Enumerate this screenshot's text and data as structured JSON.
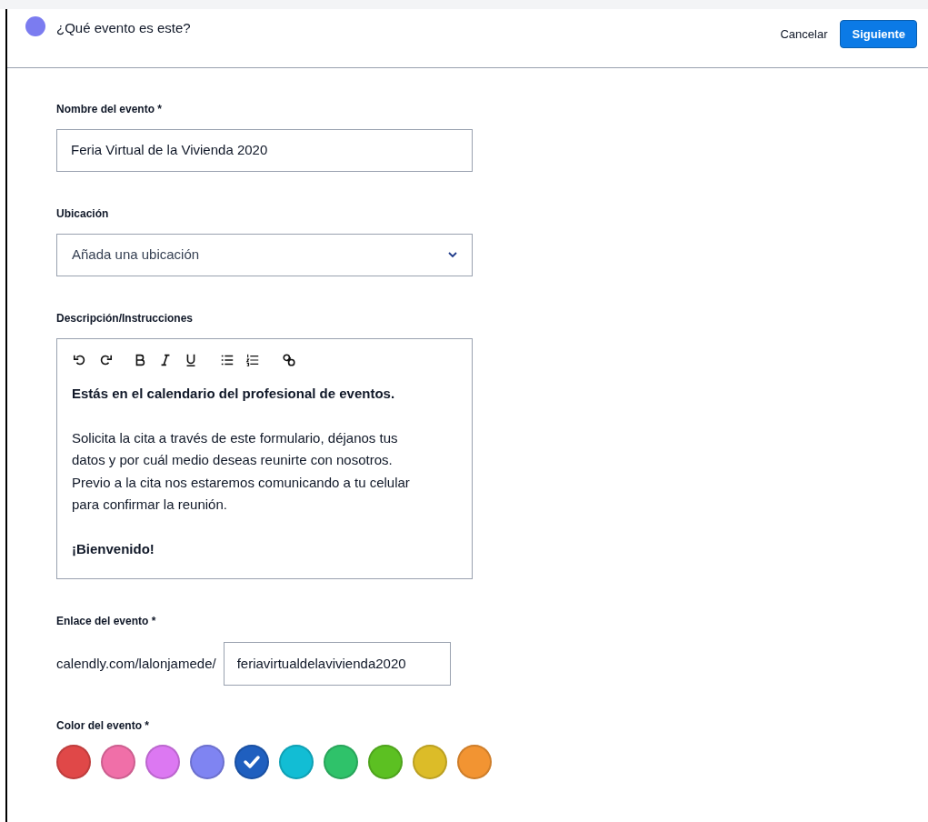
{
  "header": {
    "title": "¿Qué evento es este?",
    "color": "#7b7cf0",
    "cancel": "Cancelar",
    "next": "Siguiente"
  },
  "name_field": {
    "label": "Nombre del evento *",
    "value": "Feria Virtual de la Vivienda 2020"
  },
  "location_field": {
    "label": "Ubicación",
    "placeholder": "Añada una ubicación"
  },
  "description": {
    "label": "Descripción/Instrucciones",
    "toolbar": [
      {
        "kind": "undo"
      },
      {
        "kind": "redo"
      },
      {
        "kind": "bold"
      },
      {
        "kind": "italic"
      },
      {
        "kind": "underline"
      },
      {
        "kind": "bullets"
      },
      {
        "kind": "numbers"
      },
      {
        "kind": "link"
      }
    ],
    "paragraphs": [
      {
        "text": "Estás en el calendario del profesional de eventos.",
        "bold": true
      },
      {
        "text": "Solicita la cita a través de este formulario, déjanos tus datos y por cuál medio deseas reunirte con nosotros. Previo a la cita nos estaremos comunicando a tu celular para confirmar la reunión.",
        "bold": false
      },
      {
        "text": "¡Bienvenido!",
        "bold": true
      }
    ]
  },
  "link_field": {
    "label": "Enlace del evento *",
    "prefix": "calendly.com/lalonjamede/",
    "value": "feriavirtualdelavivienda2020"
  },
  "color_field": {
    "label": "Color del evento *",
    "colors": [
      {
        "color": "#e04848",
        "selected": false
      },
      {
        "color": "#f06fa8",
        "selected": false
      },
      {
        "color": "#dc78f2",
        "selected": false
      },
      {
        "color": "#7f84f2",
        "selected": false
      },
      {
        "color": "#1f5fbf",
        "selected": true
      },
      {
        "color": "#12bdd4",
        "selected": false
      },
      {
        "color": "#2fc26a",
        "selected": false
      },
      {
        "color": "#5cc022",
        "selected": false
      },
      {
        "color": "#dcbc28",
        "selected": false
      },
      {
        "color": "#f29432",
        "selected": false
      }
    ]
  }
}
